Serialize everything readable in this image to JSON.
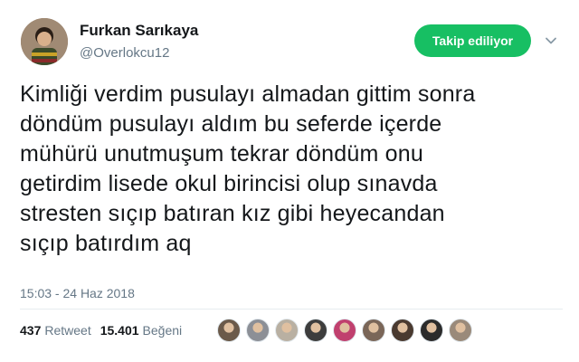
{
  "author": {
    "name": "Furkan Sarıkaya",
    "handle": "@Overlokcu12"
  },
  "follow_button": {
    "label": "Takip ediliyor",
    "color": "#17bf63"
  },
  "menu_icon": "chevron-down-icon",
  "tweet": {
    "lines": [
      "Kimliği verdim pusulayı almadan gittim sonra",
      "döndüm pusulayı aldım bu seferde içerde",
      "mühürü unutmuşum tekrar döndüm onu",
      "getirdim lisede okul birincisi olup sınavda",
      "stresten sıçıp batıran kız gibi heyecandan",
      "sıçıp batırdım aq"
    ],
    "timestamp": "15:03 - 24 Haz 2018"
  },
  "stats": {
    "retweet_count": "437",
    "retweet_label": "Retweet",
    "like_count": "15.401",
    "like_label": "Beğeni"
  },
  "likers": [
    {
      "color": "#6b5a4a"
    },
    {
      "color": "#8c8f96"
    },
    {
      "color": "#b9b0a2"
    },
    {
      "color": "#3d3d3d"
    },
    {
      "color": "#c0406e"
    },
    {
      "color": "#7a6658"
    },
    {
      "color": "#4a3a30"
    },
    {
      "color": "#2b2b2b"
    },
    {
      "color": "#9a8a7a"
    }
  ]
}
